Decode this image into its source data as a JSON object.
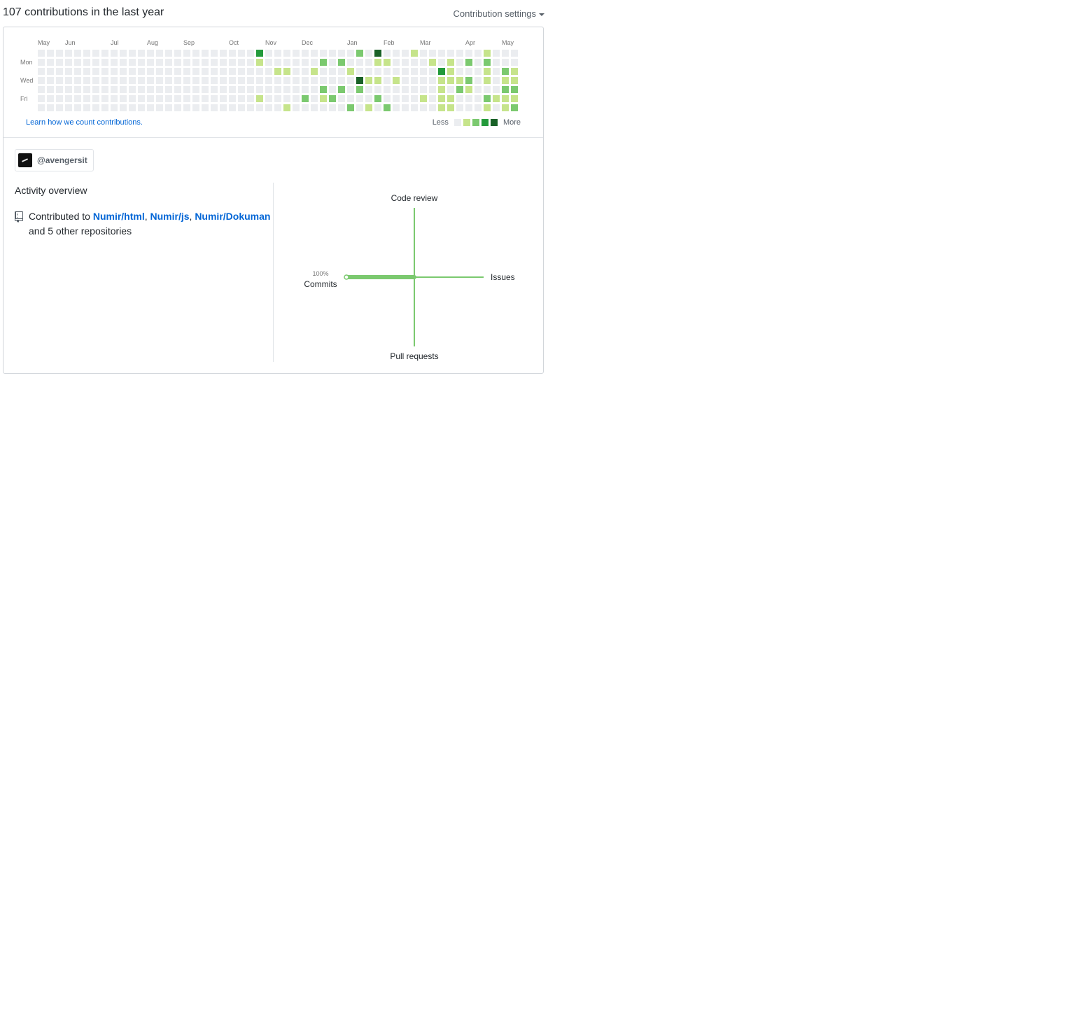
{
  "header": {
    "title": "107 contributions in the last year",
    "settings_label": "Contribution settings"
  },
  "calendar": {
    "months": [
      "May",
      "Jun",
      "Jul",
      "Aug",
      "Sep",
      "Oct",
      "Nov",
      "Dec",
      "Jan",
      "Feb",
      "Mar",
      "Apr",
      "May"
    ],
    "month_weeks": [
      0,
      3,
      8,
      12,
      16,
      21,
      25,
      29,
      34,
      38,
      42,
      47,
      51
    ],
    "day_labels": [
      "Mon",
      "Wed",
      "Fri"
    ],
    "day_label_rows": [
      1,
      3,
      5
    ],
    "weeks": 53,
    "colors": [
      "#ebedf0",
      "#c6e48b",
      "#7bc96f",
      "#239a3b",
      "#196127"
    ],
    "cells": [
      [
        24,
        0,
        3
      ],
      [
        24,
        1,
        1
      ],
      [
        24,
        5,
        1
      ],
      [
        27,
        3,
        0
      ],
      [
        26,
        2,
        1
      ],
      [
        27,
        2,
        1
      ],
      [
        27,
        6,
        1
      ],
      [
        29,
        5,
        2
      ],
      [
        30,
        2,
        1
      ],
      [
        31,
        5,
        1
      ],
      [
        31,
        1,
        2
      ],
      [
        31,
        4,
        2
      ],
      [
        32,
        5,
        2
      ],
      [
        33,
        1,
        2
      ],
      [
        33,
        4,
        2
      ],
      [
        34,
        2,
        1
      ],
      [
        34,
        6,
        2
      ],
      [
        35,
        0,
        2
      ],
      [
        35,
        3,
        4
      ],
      [
        35,
        4,
        2
      ],
      [
        36,
        3,
        1
      ],
      [
        36,
        6,
        1
      ],
      [
        37,
        0,
        4
      ],
      [
        37,
        1,
        1
      ],
      [
        37,
        3,
        1
      ],
      [
        37,
        5,
        2
      ],
      [
        38,
        1,
        1
      ],
      [
        38,
        6,
        2
      ],
      [
        39,
        3,
        1
      ],
      [
        41,
        0,
        1
      ],
      [
        42,
        5,
        1
      ],
      [
        43,
        1,
        1
      ],
      [
        44,
        2,
        3
      ],
      [
        44,
        3,
        1
      ],
      [
        44,
        4,
        1
      ],
      [
        44,
        5,
        1
      ],
      [
        44,
        6,
        1
      ],
      [
        45,
        1,
        1
      ],
      [
        45,
        2,
        1
      ],
      [
        45,
        3,
        1
      ],
      [
        45,
        5,
        1
      ],
      [
        45,
        6,
        1
      ],
      [
        46,
        3,
        1
      ],
      [
        46,
        4,
        2
      ],
      [
        47,
        1,
        2
      ],
      [
        47,
        3,
        2
      ],
      [
        47,
        4,
        1
      ],
      [
        49,
        0,
        1
      ],
      [
        49,
        1,
        2
      ],
      [
        49,
        2,
        1
      ],
      [
        49,
        3,
        1
      ],
      [
        49,
        5,
        2
      ],
      [
        49,
        6,
        1
      ],
      [
        50,
        5,
        1
      ],
      [
        51,
        2,
        2
      ],
      [
        51,
        3,
        1
      ],
      [
        51,
        4,
        2
      ],
      [
        51,
        5,
        1
      ],
      [
        51,
        6,
        1
      ],
      [
        52,
        2,
        1
      ],
      [
        52,
        3,
        1
      ],
      [
        52,
        4,
        2
      ],
      [
        52,
        5,
        1
      ],
      [
        52,
        6,
        2
      ]
    ]
  },
  "footer": {
    "learn_link": "Learn how we count contributions.",
    "less": "Less",
    "more": "More"
  },
  "org": {
    "name": "@avengersit"
  },
  "activity": {
    "title": "Activity overview",
    "contributed_prefix": "Contributed to",
    "repo1": "Numir/html",
    "sep1": ",",
    "repo2": "Numir/js",
    "sep2": ",",
    "repo3": "Numir/Dokuman",
    "suffix": "and 5 other repositories"
  },
  "radar": {
    "code_review": "Code review",
    "issues": "Issues",
    "pull_requests": "Pull requests",
    "commits": "Commits",
    "commits_pct": "100%",
    "commits_value": 100,
    "issues_value": 0,
    "code_review_value": 0,
    "pull_requests_value": 0,
    "axis_color": "#7bc96f"
  }
}
